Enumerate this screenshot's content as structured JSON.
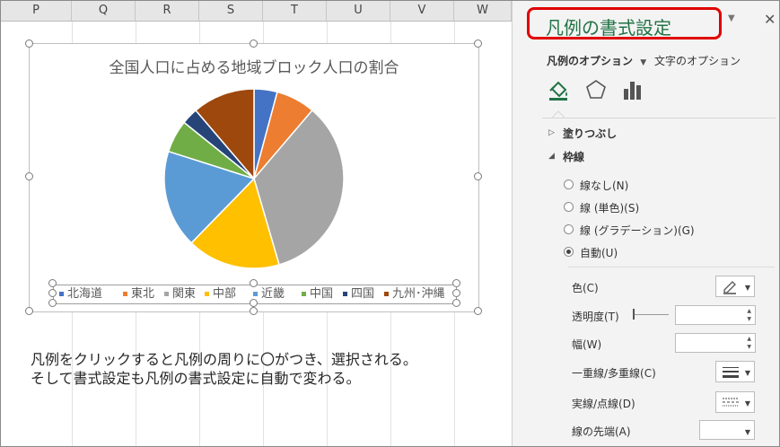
{
  "columns": [
    "P",
    "Q",
    "R",
    "S",
    "T",
    "U",
    "V",
    "W"
  ],
  "chart_data": {
    "type": "pie",
    "title": "全国人口に占める地域ブロック人口の割合",
    "categories": [
      "北海道",
      "東北",
      "関東",
      "中部",
      "近畿",
      "中国",
      "四国",
      "九州･沖縄"
    ],
    "values": [
      4.2,
      7.1,
      34.4,
      16.9,
      17.7,
      5.9,
      3.0,
      11.3
    ],
    "colors": [
      "#4472c4",
      "#ed7d31",
      "#a5a5a5",
      "#ffc000",
      "#5b9bd5",
      "#70ad47",
      "#264478",
      "#9e480e"
    ],
    "legend_position": "bottom"
  },
  "note": {
    "line1": "凡例をクリックすると凡例の周りに〇がつき、選択される。",
    "line2": "そして書式設定も凡例の書式設定に自動で変わる。"
  },
  "pane": {
    "title": "凡例の書式設定",
    "tab_legend_options": "凡例のオプション",
    "tab_text_options": "文字のオプション",
    "icons": [
      "fill-line-icon",
      "effects-pentagon-icon",
      "size-properties-icon"
    ],
    "section_fill": "塗りつぶし",
    "section_border": "枠線",
    "radios": [
      {
        "label": "線なし(N)",
        "selected": false
      },
      {
        "label": "線 (単色)(S)",
        "selected": false
      },
      {
        "label": "線 (グラデーション)(G)",
        "selected": false
      },
      {
        "label": "自動(U)",
        "selected": true
      }
    ],
    "labels": {
      "color": "色(C)",
      "transparency": "透明度(T)",
      "width": "幅(W)",
      "compound": "一重線/多重線(C)",
      "dash": "実線/点線(D)",
      "cap": "線の先端(A)"
    }
  }
}
